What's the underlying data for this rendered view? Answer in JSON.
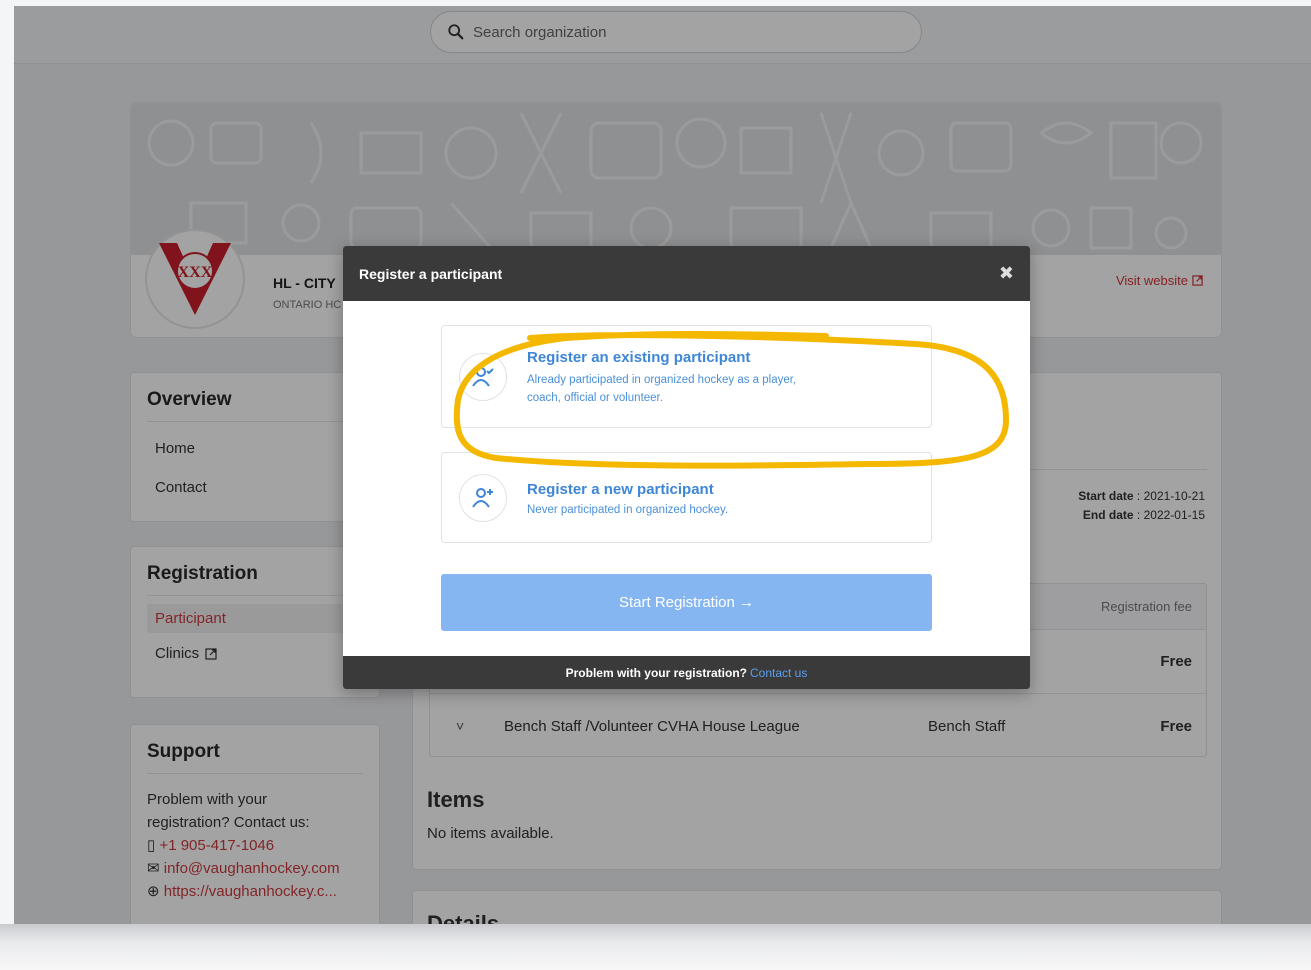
{
  "search": {
    "placeholder": "Search organization"
  },
  "org": {
    "name": "HL - CITY",
    "subtitle": "ONTARIO HC",
    "visit_website": "Visit website"
  },
  "sidebar": {
    "overview": {
      "title": "Overview",
      "items": [
        {
          "label": "Home"
        },
        {
          "label": "Contact"
        }
      ]
    },
    "registration": {
      "title": "Registration",
      "items": [
        {
          "label": "Participant",
          "active": true
        },
        {
          "label": "Clinics",
          "external": true
        }
      ]
    },
    "support": {
      "title": "Support",
      "text_line1": "Problem with your",
      "text_line2": "registration? Contact us:",
      "phone": "+1 905-417-1046",
      "email": "info@vaughanhockey.com",
      "website": "https://vaughanhockey.c..."
    }
  },
  "main": {
    "dates": {
      "start_label": "Start date",
      "start_value": "2021-10-21",
      "end_label": "End date",
      "end_value": "2022-01-15"
    },
    "table": {
      "header_fee": "Registration fee",
      "rows": [
        {
          "name": "",
          "type": "",
          "fee": "Free"
        },
        {
          "name": "Bench Staff /Volunteer CVHA House League",
          "type": "Bench Staff",
          "fee": "Free"
        }
      ]
    },
    "items": {
      "title": "Items",
      "empty": "No items available."
    },
    "details": {
      "title": "Details"
    }
  },
  "modal": {
    "title": "Register a participant",
    "options": [
      {
        "title": "Register an existing participant",
        "desc_line1": "Already participated in organized hockey as a player,",
        "desc_line2": "coach, official or volunteer."
      },
      {
        "title": "Register a new participant",
        "desc_line1": "Never participated in organized hockey.",
        "desc_line2": ""
      }
    ],
    "start_button": "Start Registration →",
    "footer_text": "Problem with your registration?",
    "footer_link": "Contact us"
  },
  "colors": {
    "accent_red": "#cc3a3f",
    "modal_blue": "#3d86d8",
    "button_blue": "#86b6f1",
    "highlight_yellow": "#f5b800"
  }
}
